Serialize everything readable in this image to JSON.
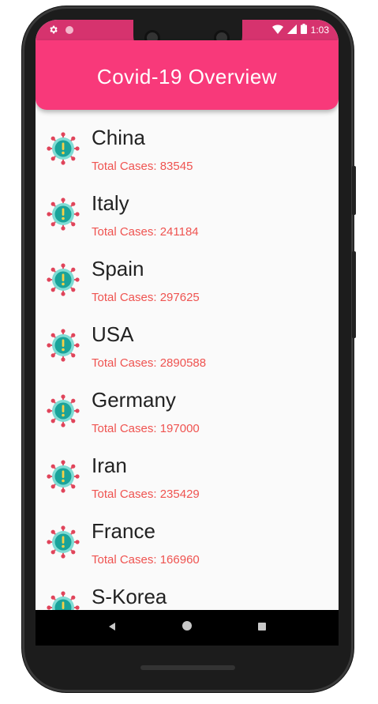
{
  "status_bar": {
    "time": "1:03"
  },
  "app_bar": {
    "title": "Covid-19  Overview"
  },
  "countries": [
    {
      "name": "China",
      "cases_label": "Total Cases: 83545"
    },
    {
      "name": "Italy",
      "cases_label": "Total Cases: 241184"
    },
    {
      "name": "Spain",
      "cases_label": "Total Cases: 297625"
    },
    {
      "name": "USA",
      "cases_label": "Total Cases: 2890588"
    },
    {
      "name": "Germany",
      "cases_label": "Total Cases: 197000"
    },
    {
      "name": "Iran",
      "cases_label": "Total Cases: 235429"
    },
    {
      "name": "France",
      "cases_label": "Total Cases: 166960"
    },
    {
      "name": "S-Korea",
      "cases_label": ""
    }
  ],
  "nav": {
    "back_icon": "back-triangle-icon",
    "home_icon": "home-circle-icon",
    "recents_icon": "recents-square-icon"
  },
  "colors": {
    "app_bar": "#f8397a",
    "status_bar": "#d6336e",
    "cases_text": "#ef5350",
    "virus_teal": "#1aa39a"
  }
}
